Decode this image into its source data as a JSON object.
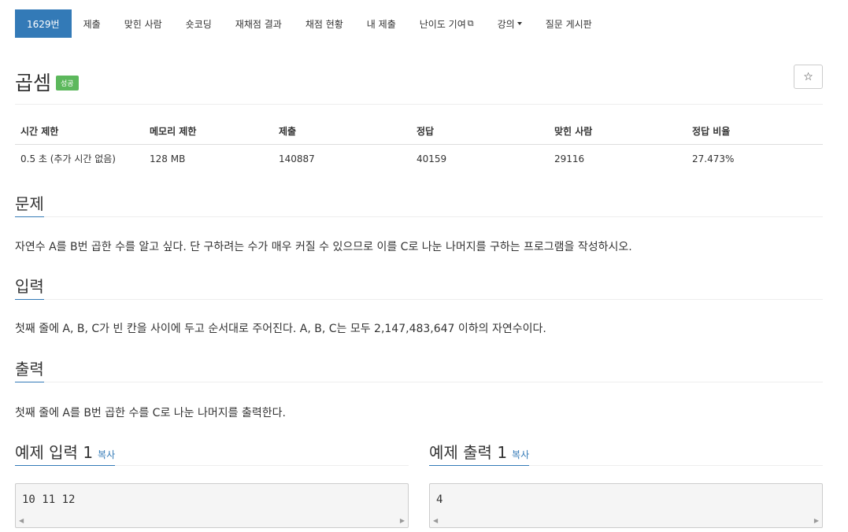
{
  "nav": {
    "tabs": [
      {
        "label": "1629번"
      },
      {
        "label": "제출"
      },
      {
        "label": "맞힌 사람"
      },
      {
        "label": "숏코딩"
      },
      {
        "label": "재채점 결과"
      },
      {
        "label": "채점 현황"
      },
      {
        "label": "내 제출"
      },
      {
        "label": "난이도 기여"
      },
      {
        "label": "강의"
      },
      {
        "label": "질문 게시판"
      }
    ]
  },
  "problem": {
    "title": "곱셈",
    "status_badge": "성공",
    "star_icon": "star-icon"
  },
  "stats": {
    "headers": [
      "시간 제한",
      "메모리 제한",
      "제출",
      "정답",
      "맞힌 사람",
      "정답 비율"
    ],
    "values": [
      "0.5 초 (추가 시간 없음)",
      "128 MB",
      "140887",
      "40159",
      "29116",
      "27.473%"
    ]
  },
  "sections": {
    "description": {
      "heading": "문제",
      "text": "자연수 A를 B번 곱한 수를 알고 싶다. 단 구하려는 수가 매우 커질 수 있으므로 이를 C로 나눈 나머지를 구하는 프로그램을 작성하시오."
    },
    "input": {
      "heading": "입력",
      "text": "첫째 줄에 A, B, C가 빈 칸을 사이에 두고 순서대로 주어진다. A, B, C는 모두 2,147,483,647 이하의 자연수이다."
    },
    "output": {
      "heading": "출력",
      "text": "첫째 줄에 A를 B번 곱한 수를 C로 나눈 나머지를 출력한다."
    }
  },
  "samples": {
    "copy_label": "복사",
    "input": {
      "heading": "예제 입력 1",
      "code": "10 11 12"
    },
    "output": {
      "heading": "예제 출력 1",
      "code": "4"
    }
  },
  "colors": {
    "accent": "#337ab7",
    "success": "#5cb85c"
  }
}
